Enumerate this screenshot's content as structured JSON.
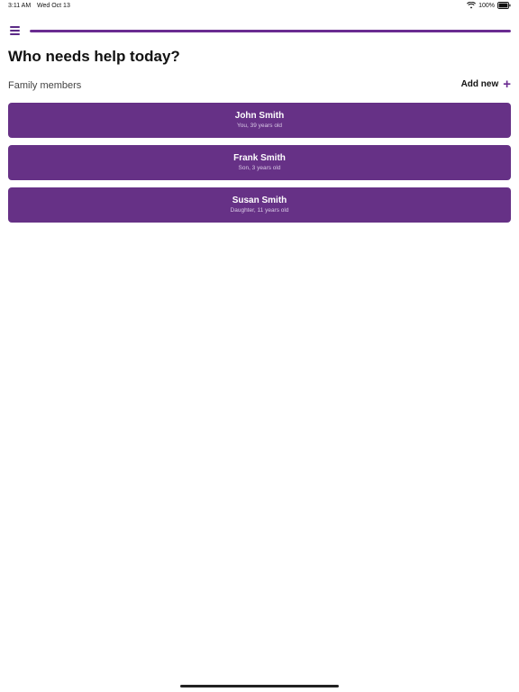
{
  "status_bar": {
    "time": "3:11 AM",
    "date": "Wed Oct 13",
    "battery": "100%"
  },
  "header": {
    "menu_icon": "hamburger-menu-icon",
    "progress": 1.0,
    "accent_color": "#663186"
  },
  "page": {
    "title": "Who needs help today?"
  },
  "family": {
    "section_label": "Family members",
    "add_new_label": "Add new",
    "add_icon": "plus-icon",
    "members": [
      {
        "name": "John Smith",
        "detail": "You, 39 years old"
      },
      {
        "name": "Frank Smith",
        "detail": "Son, 3 years old"
      },
      {
        "name": "Susan Smith",
        "detail": "Daughter, 11 years old"
      }
    ]
  }
}
